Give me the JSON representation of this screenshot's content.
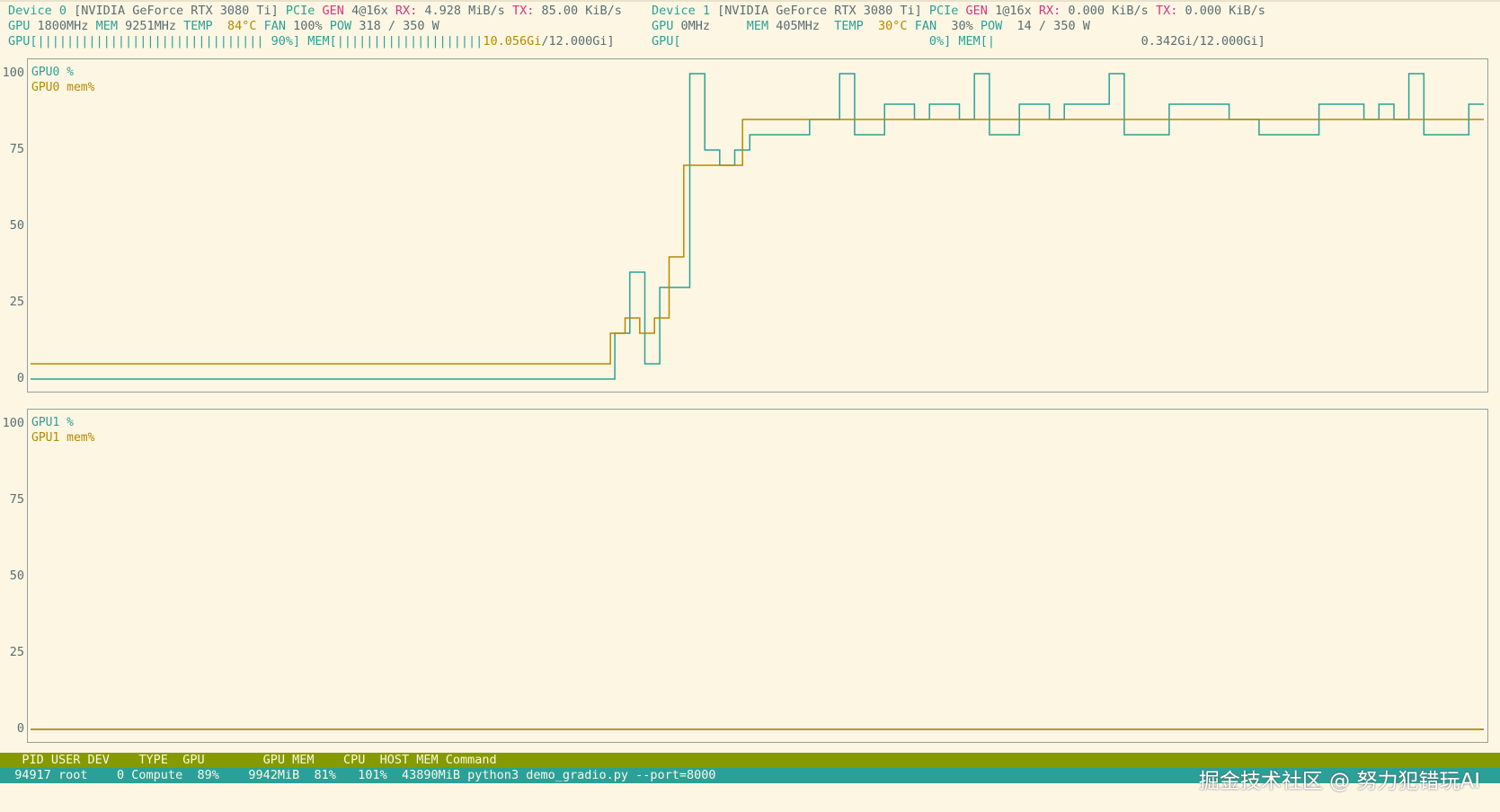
{
  "dev0": {
    "label": "Device 0",
    "name": "[NVIDIA GeForce RTX 3080 Ti]",
    "pcie": "PCIe",
    "gen": "GEN",
    "gen_val": "4@16x",
    "rx": "RX:",
    "rx_val": "4.928 MiB/s",
    "tx": "TX:",
    "tx_val": "85.00 KiB/s",
    "gpu_l": "GPU",
    "gpu_clock": "1800MHz",
    "mem_l": "MEM",
    "mem_clock": "9251MHz",
    "temp_l": "TEMP",
    "temp_val": "84°C",
    "fan_l": "FAN",
    "fan_val": "100%",
    "pow_l": "POW",
    "pow_val": "318 / 350 W",
    "gpu_bar": "GPU[||||||||||||||||||||||||||||||| 90%]",
    "mem_bar_pre": "MEM[||||||||||||||||||||",
    "mem_bar_val": "10.056Gi",
    "mem_bar_post": "/12.000Gi]"
  },
  "dev1": {
    "label": "Device 1",
    "name": "[NVIDIA GeForce RTX 3080 Ti]",
    "pcie": "PCIe",
    "gen": "GEN",
    "gen_val": "1@16x",
    "rx": "RX:",
    "rx_val": "0.000 KiB/s",
    "tx": "TX:",
    "tx_val": "0.000 KiB/s",
    "gpu_l": "GPU",
    "gpu_clock": "0MHz",
    "mem_l": "MEM",
    "mem_clock": "405MHz",
    "temp_l": "TEMP",
    "temp_val": "30°C",
    "fan_l": "FAN",
    "fan_val": "30%",
    "pow_l": "POW",
    "pow_val": "14 / 350 W",
    "gpu_bar": "GPU[                                  0%]",
    "mem_bar_pre": "MEM[|",
    "mem_bar_post": "0.342Gi/12.000Gi]"
  },
  "chart_data": [
    {
      "type": "line",
      "ylim": [
        0,
        100
      ],
      "yticks": [
        "100",
        "75",
        "50",
        "25",
        "0"
      ],
      "series": [
        {
          "name": "GPU0 %",
          "color": "#2aa198",
          "values": [
            0,
            0,
            0,
            0,
            0,
            0,
            0,
            0,
            0,
            0,
            0,
            0,
            0,
            0,
            0,
            0,
            0,
            0,
            0,
            0,
            0,
            0,
            0,
            0,
            0,
            0,
            0,
            0,
            0,
            0,
            0,
            0,
            0,
            0,
            0,
            0,
            0,
            0,
            0,
            0,
            0,
            0,
            0,
            0,
            0,
            0,
            0,
            0,
            0,
            0,
            0,
            0,
            0,
            0,
            0,
            0,
            0,
            0,
            0,
            0,
            0,
            0,
            0,
            0,
            0,
            0,
            0,
            0,
            0,
            0,
            0,
            0,
            0,
            0,
            0,
            0,
            0,
            0,
            15,
            15,
            35,
            35,
            5,
            5,
            30,
            30,
            30,
            30,
            100,
            100,
            75,
            75,
            70,
            70,
            75,
            75,
            80,
            80,
            80,
            80,
            80,
            80,
            80,
            80,
            85,
            85,
            85,
            85,
            100,
            100,
            80,
            80,
            80,
            80,
            90,
            90,
            90,
            90,
            85,
            85,
            90,
            90,
            90,
            90,
            85,
            85,
            100,
            100,
            80,
            80,
            80,
            80,
            90,
            90,
            90,
            90,
            85,
            85,
            90,
            90,
            90,
            90,
            90,
            90,
            100,
            100,
            80,
            80,
            80,
            80,
            80,
            80,
            90,
            90,
            90,
            90,
            90,
            90,
            90,
            90,
            85,
            85,
            85,
            85,
            80,
            80,
            80,
            80,
            80,
            80,
            80,
            80,
            90,
            90,
            90,
            90,
            90,
            90,
            85,
            85,
            90,
            90,
            85,
            85,
            100,
            100,
            80,
            80,
            80,
            80,
            80,
            80,
            90,
            90
          ]
        },
        {
          "name": "GPU0 mem%",
          "color": "#b58900",
          "values": [
            5,
            5,
            5,
            5,
            5,
            5,
            5,
            5,
            5,
            5,
            5,
            5,
            5,
            5,
            5,
            5,
            5,
            5,
            5,
            5,
            5,
            5,
            5,
            5,
            5,
            5,
            5,
            5,
            5,
            5,
            5,
            5,
            5,
            5,
            5,
            5,
            5,
            5,
            5,
            5,
            5,
            5,
            5,
            5,
            5,
            5,
            5,
            5,
            5,
            5,
            5,
            5,
            5,
            5,
            5,
            5,
            5,
            5,
            5,
            5,
            5,
            5,
            5,
            5,
            5,
            5,
            5,
            5,
            5,
            5,
            5,
            5,
            5,
            5,
            5,
            5,
            5,
            5,
            5,
            15,
            15,
            20,
            20,
            15,
            15,
            20,
            20,
            40,
            40,
            70,
            70,
            70,
            70,
            70,
            70,
            70,
            70,
            85,
            85,
            85,
            85,
            85,
            85,
            85,
            85,
            85,
            85,
            85,
            85,
            85,
            85,
            85,
            85,
            85,
            85,
            85,
            85,
            85,
            85,
            85,
            85,
            85,
            85,
            85,
            85,
            85,
            85,
            85,
            85,
            85,
            85,
            85,
            85,
            85,
            85,
            85,
            85,
            85,
            85,
            85,
            85,
            85,
            85,
            85,
            85,
            85,
            85,
            85,
            85,
            85,
            85,
            85,
            85,
            85,
            85,
            85,
            85,
            85,
            85,
            85,
            85,
            85,
            85,
            85,
            85,
            85,
            85,
            85,
            85,
            85,
            85,
            85,
            85,
            85,
            85,
            85,
            85,
            85,
            85,
            85,
            85,
            85,
            85,
            85,
            85,
            85,
            85,
            85,
            85,
            85,
            85,
            85,
            85,
            85,
            85,
            85,
            85,
            85
          ]
        }
      ]
    },
    {
      "type": "line",
      "ylim": [
        0,
        100
      ],
      "yticks": [
        "100",
        "75",
        "50",
        "25",
        "0"
      ],
      "series": [
        {
          "name": "GPU1 %",
          "color": "#2aa198",
          "values": [
            0,
            0
          ]
        },
        {
          "name": "GPU1 mem%",
          "color": "#b58900",
          "values": [
            0,
            0
          ]
        }
      ]
    }
  ],
  "process_table": {
    "header": "   PID USER DEV    TYPE  GPU        GPU MEM    CPU  HOST MEM Command",
    "rows": [
      "  94917 root    0 Compute  89%    9942MiB  81%   101%  43890MiB python3 demo_gradio.py --port=8000"
    ]
  },
  "watermark": "掘金技术社区 @ 努力犯错玩AI"
}
